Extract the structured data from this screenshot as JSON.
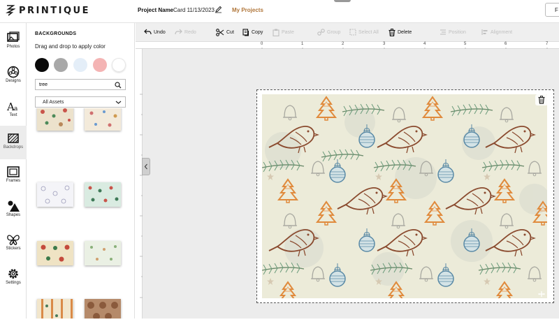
{
  "app": {
    "logo_text": "PRINTIQUE"
  },
  "header": {
    "project_label": "Project Name",
    "project_name": "Card 11/13/2023",
    "my_projects": "My Projects",
    "right_button": "F"
  },
  "nav": {
    "items": [
      {
        "label": "Photos",
        "icon": "photos-icon"
      },
      {
        "label": "Designs",
        "icon": "designs-icon"
      },
      {
        "label": "Text",
        "icon": "text-icon"
      },
      {
        "label": "Backdrops",
        "icon": "backdrops-icon"
      },
      {
        "label": "Frames",
        "icon": "frames-icon"
      },
      {
        "label": "Shapes",
        "icon": "shapes-icon"
      },
      {
        "label": "Stickers",
        "icon": "stickers-icon"
      },
      {
        "label": "Settings",
        "icon": "settings-icon"
      }
    ],
    "active": "Backdrops"
  },
  "panel": {
    "title": "BACKGROUNDS",
    "subtitle": "Drag and drop to apply color",
    "swatches": [
      "#0a0a0a",
      "#a8a8a8",
      "#e4eef8",
      "#f4b4b4",
      "#ffffff"
    ],
    "search": {
      "value": "tree",
      "placeholder": ""
    },
    "filter": {
      "selected": "All Assets"
    }
  },
  "toolbar": {
    "undo": "Undo",
    "redo": "Redo",
    "cut": "Cut",
    "copy": "Copy",
    "paste": "Paste",
    "group": "Group",
    "select_all": "Select All",
    "delete": "Delete",
    "position": "Position",
    "alignment": "Alignment"
  },
  "ruler": {
    "h_ticks": [
      "0",
      "1",
      "2",
      "3",
      "4",
      "5",
      "6",
      "7"
    ]
  },
  "colors": {
    "accent": "#b0763a",
    "card_background": "#ecebd9"
  }
}
